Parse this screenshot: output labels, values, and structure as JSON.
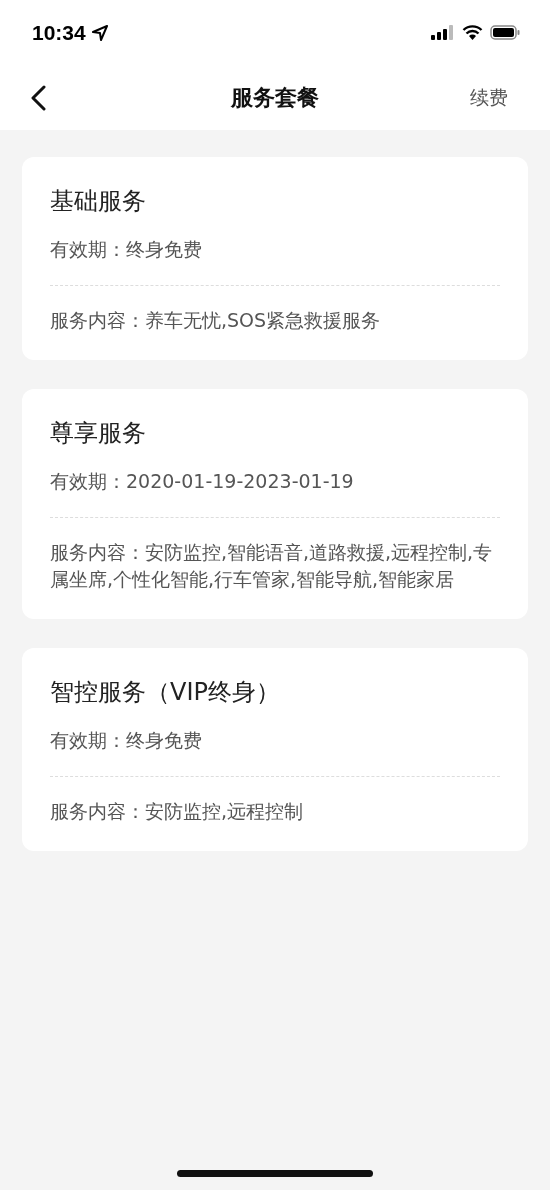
{
  "status_bar": {
    "time": "10:34"
  },
  "nav": {
    "title": "服务套餐",
    "action": "续费"
  },
  "cards": [
    {
      "title": "基础服务",
      "validity": "有效期：终身免费",
      "content": "服务内容：养车无忧,SOS紧急救援服务"
    },
    {
      "title": "尊享服务",
      "validity": "有效期：2020-01-19-2023-01-19",
      "content": "服务内容：安防监控,智能语音,道路救援,远程控制,专属坐席,个性化智能,行车管家,智能导航,智能家居"
    },
    {
      "title": "智控服务（VIP终身）",
      "validity": "有效期：终身免费",
      "content": "服务内容：安防监控,远程控制"
    }
  ]
}
